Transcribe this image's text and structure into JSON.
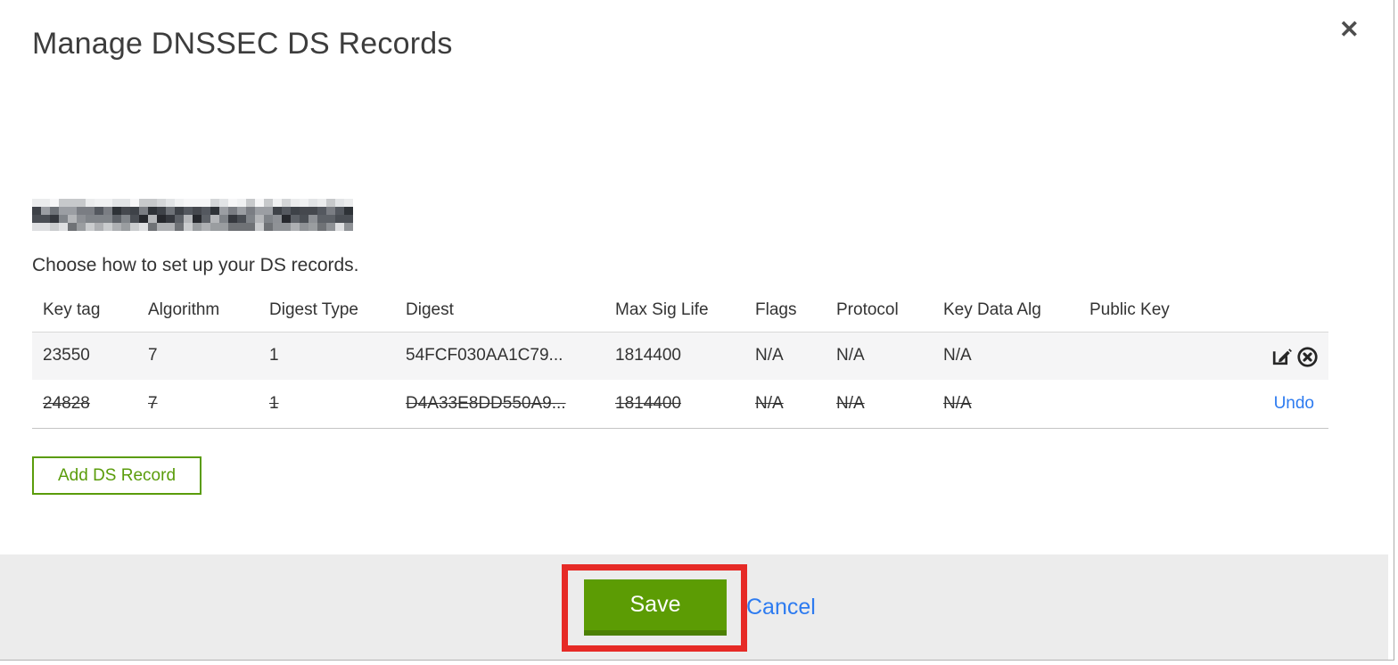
{
  "modal": {
    "title": "Manage DNSSEC DS Records",
    "close_icon": "✕",
    "subtitle": "Choose how to set up your DS records."
  },
  "table": {
    "headers": {
      "key_tag": "Key tag",
      "algorithm": "Algorithm",
      "digest_type": "Digest Type",
      "digest": "Digest",
      "max_sig_life": "Max Sig Life",
      "flags": "Flags",
      "protocol": "Protocol",
      "key_data_alg": "Key Data Alg",
      "public_key": "Public Key"
    },
    "rows": [
      {
        "key_tag": "23550",
        "algorithm": "7",
        "digest_type": "1",
        "digest": "54FCF030AA1C79...",
        "max_sig_life": "1814400",
        "flags": "N/A",
        "protocol": "N/A",
        "key_data_alg": "N/A",
        "public_key": "",
        "state": "normal"
      },
      {
        "key_tag": "24828",
        "algorithm": "7",
        "digest_type": "1",
        "digest": "D4A33E8DD550A9...",
        "max_sig_life": "1814400",
        "flags": "N/A",
        "protocol": "N/A",
        "key_data_alg": "N/A",
        "public_key": "",
        "state": "deleted",
        "undo_label": "Undo"
      }
    ]
  },
  "buttons": {
    "add_ds_record": "Add DS Record",
    "save": "Save",
    "cancel": "Cancel"
  },
  "colors": {
    "action_green": "#5c9c04",
    "action_green_dark": "#4c8004",
    "outline_green": "#5a9c0b",
    "link_blue": "#2d7bf0",
    "annotation_red": "#e62a26",
    "footer_bg": "#ececec",
    "row_bg": "#f5f5f6"
  }
}
